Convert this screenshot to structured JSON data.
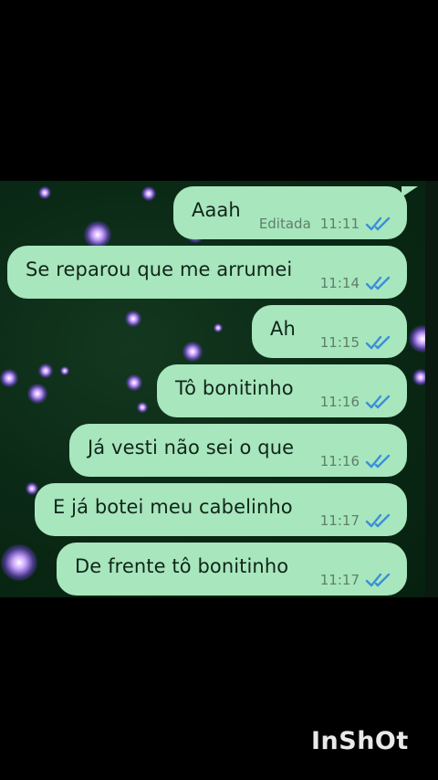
{
  "messages": [
    {
      "text": "Aaah",
      "edited_label": "Editada",
      "time": "11:11",
      "status_icon": "double-check-read-icon"
    },
    {
      "text": "Se reparou que me arrumei",
      "time": "11:14",
      "status_icon": "double-check-read-icon"
    },
    {
      "text": "Ah",
      "time": "11:15",
      "status_icon": "double-check-read-icon"
    },
    {
      "text": "Tô bonitinho",
      "time": "11:16",
      "status_icon": "double-check-read-icon"
    },
    {
      "text": "Já vesti não sei o que",
      "time": "11:16",
      "status_icon": "double-check-read-icon"
    },
    {
      "text": "E já botei meu cabelinho",
      "time": "11:17",
      "status_icon": "double-check-read-icon"
    },
    {
      "text": "De frente tô bonitinho",
      "time": "11:17",
      "status_icon": "double-check-read-icon"
    }
  ],
  "watermark": "InShOt",
  "colors": {
    "bubble": "#a8e6bd",
    "read_ticks": "#3b8fd9",
    "chat_background": "#0b2a16"
  }
}
